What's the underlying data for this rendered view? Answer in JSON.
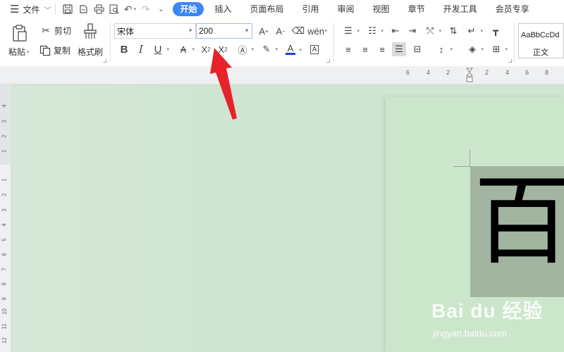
{
  "menubar": {
    "file_label": "文件",
    "tabs": [
      {
        "label": "开始",
        "active": true
      },
      {
        "label": "插入"
      },
      {
        "label": "页面布局"
      },
      {
        "label": "引用"
      },
      {
        "label": "审阅"
      },
      {
        "label": "视图"
      },
      {
        "label": "章节"
      },
      {
        "label": "开发工具"
      },
      {
        "label": "会员专享"
      }
    ]
  },
  "clipboard": {
    "cut_label": "剪切",
    "paste_label": "粘贴",
    "copy_label": "复制",
    "format_painter_label": "格式刷"
  },
  "font": {
    "family": "宋体",
    "size": "200"
  },
  "styles": {
    "sample_text": "AaBbCcDd",
    "style_name": "正文"
  },
  "hruler_numbers": [
    "6",
    "4",
    "2",
    "2",
    "4",
    "6",
    "8"
  ],
  "vruler_numbers": [
    "4",
    "3",
    "2",
    "1",
    "1",
    "2",
    "3",
    "4",
    "5",
    "6",
    "7",
    "8",
    "9",
    "10",
    "11",
    "12"
  ],
  "document": {
    "character": "百"
  },
  "watermark": {
    "logo": "Bai du 经验",
    "url": "jingyan.baidu.com"
  },
  "colors": {
    "accent": "#3a86f4",
    "annotation_arrow": "#e8222a",
    "canvas": "#cfe5d1",
    "page": "#cce6cc",
    "selection": "#a2b5a1",
    "font_color_bar": "#1a3cf0"
  }
}
